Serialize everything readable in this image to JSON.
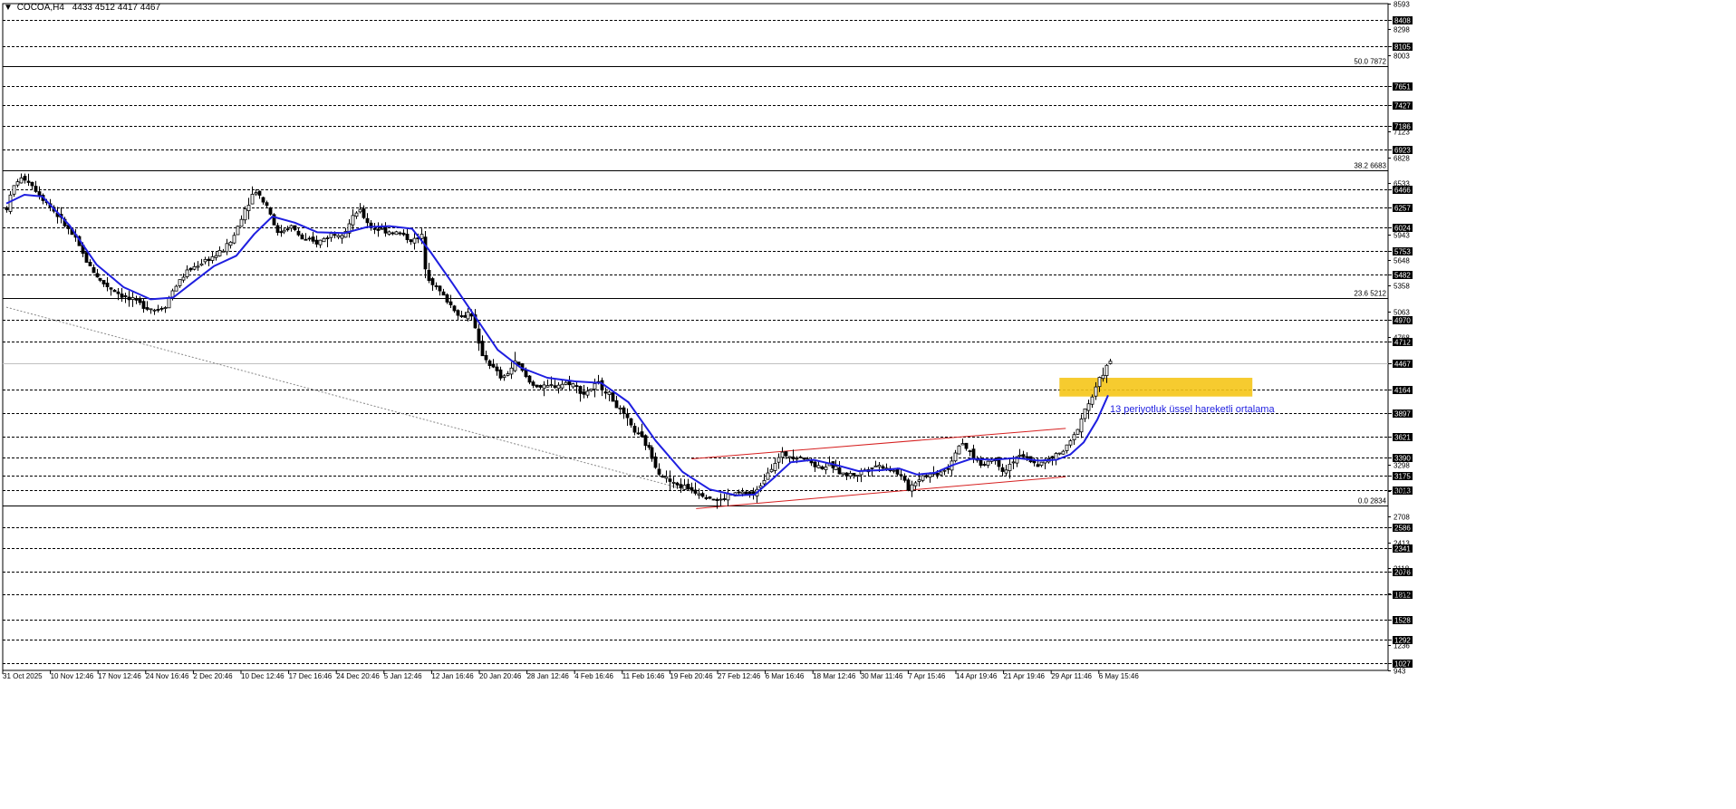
{
  "header": {
    "symbol": "COCOA,H4",
    "ohlc": "4433 4512 4417 4467"
  },
  "annotation": {
    "text": "13 periyotluk üssel hareketli ortalama"
  },
  "colors": {
    "candle": "#000000",
    "ema": "#1f1fe0",
    "channel": "#d62020",
    "zone": "#f5c518",
    "annotation": "#1f1fe0",
    "grid": "#000000",
    "fib": "#000000"
  },
  "chart_data": {
    "type": "candlestick",
    "title": "COCOA,H4",
    "ylim": [
      943,
      8593
    ],
    "grid": true,
    "y_ticks_plain": [
      8593,
      8298,
      8003,
      7123,
      6828,
      6533,
      5943,
      5648,
      5358,
      5063,
      4768,
      3298,
      3003,
      2708,
      2413,
      2118,
      1823,
      1236,
      943
    ],
    "y_levels_boxed": [
      8408,
      8105,
      7651,
      7427,
      7186,
      6923,
      6466,
      6257,
      6024,
      5753,
      5482,
      4970,
      4712,
      4467,
      4164,
      3897,
      3621,
      3390,
      3175,
      3013,
      2586,
      2341,
      2076,
      1812,
      1528,
      1292,
      1027
    ],
    "fib_levels": [
      {
        "label": "50.0 7872",
        "value": 7872
      },
      {
        "label": "38.2 6683",
        "value": 6683
      },
      {
        "label": "23.6 5212",
        "value": 5212
      },
      {
        "label": "0.0 2834",
        "value": 2834
      }
    ],
    "x_labels": [
      "31 Oct 2025",
      "10 Nov 12:46",
      "17 Nov 12:46",
      "24 Nov 16:46",
      "2 Dec 20:46",
      "10 Dec 12:46",
      "17 Dec 16:46",
      "24 Dec 20:46",
      "5 Jan 12:46",
      "12 Jan 16:46",
      "20 Jan 20:46",
      "28 Jan 12:46",
      "4 Feb 16:46",
      "11 Feb 16:46",
      "19 Feb 20:46",
      "27 Feb 12:46",
      "6 Mar 16:46",
      "18 Mar 12:46",
      "30 Mar 11:46",
      "7 Apr 15:46",
      "14 Apr 19:46",
      "21 Apr 19:46",
      "29 Apr 11:46",
      "6 May 15:46"
    ],
    "price_path": [
      [
        0,
        6250
      ],
      [
        10,
        6560
      ],
      [
        22,
        6590
      ],
      [
        35,
        6420
      ],
      [
        55,
        6180
      ],
      [
        75,
        5900
      ],
      [
        90,
        5600
      ],
      [
        105,
        5400
      ],
      [
        120,
        5300
      ],
      [
        135,
        5200
      ],
      [
        150,
        5140
      ],
      [
        165,
        5080
      ],
      [
        175,
        5120
      ],
      [
        185,
        5320
      ],
      [
        200,
        5520
      ],
      [
        220,
        5650
      ],
      [
        235,
        5720
      ],
      [
        250,
        5880
      ],
      [
        262,
        6200
      ],
      [
        275,
        6460
      ],
      [
        290,
        6250
      ],
      [
        300,
        5950
      ],
      [
        315,
        6050
      ],
      [
        330,
        5870
      ],
      [
        345,
        5850
      ],
      [
        360,
        5950
      ],
      [
        375,
        5980
      ],
      [
        390,
        6230
      ],
      [
        405,
        6020
      ],
      [
        420,
        5990
      ],
      [
        435,
        5960
      ],
      [
        450,
        5870
      ],
      [
        460,
        5920
      ],
      [
        465,
        5500
      ],
      [
        475,
        5350
      ],
      [
        490,
        5160
      ],
      [
        505,
        4980
      ],
      [
        515,
        5080
      ],
      [
        525,
        4620
      ],
      [
        535,
        4470
      ],
      [
        550,
        4280
      ],
      [
        565,
        4480
      ],
      [
        580,
        4250
      ],
      [
        595,
        4180
      ],
      [
        610,
        4220
      ],
      [
        625,
        4250
      ],
      [
        640,
        4120
      ],
      [
        655,
        4230
      ],
      [
        665,
        4150
      ],
      [
        680,
        3920
      ],
      [
        695,
        3700
      ],
      [
        710,
        3520
      ],
      [
        725,
        3200
      ],
      [
        740,
        3080
      ],
      [
        755,
        3040
      ],
      [
        770,
        2980
      ],
      [
        790,
        2880
      ],
      [
        800,
        2950
      ],
      [
        815,
        2980
      ],
      [
        830,
        2960
      ],
      [
        845,
        3250
      ],
      [
        860,
        3420
      ],
      [
        880,
        3400
      ],
      [
        900,
        3280
      ],
      [
        915,
        3290
      ],
      [
        930,
        3180
      ],
      [
        945,
        3200
      ],
      [
        960,
        3300
      ],
      [
        975,
        3280
      ],
      [
        990,
        3200
      ],
      [
        1000,
        3030
      ],
      [
        1015,
        3180
      ],
      [
        1030,
        3200
      ],
      [
        1045,
        3280
      ],
      [
        1055,
        3530
      ],
      [
        1065,
        3480
      ],
      [
        1080,
        3300
      ],
      [
        1095,
        3380
      ],
      [
        1105,
        3230
      ],
      [
        1120,
        3400
      ],
      [
        1135,
        3360
      ],
      [
        1145,
        3300
      ],
      [
        1160,
        3380
      ],
      [
        1175,
        3480
      ],
      [
        1185,
        3650
      ],
      [
        1195,
        3920
      ],
      [
        1205,
        4100
      ],
      [
        1212,
        4280
      ],
      [
        1218,
        4400
      ],
      [
        1224,
        4467
      ]
    ],
    "ema_path": [
      [
        0,
        6300
      ],
      [
        20,
        6400
      ],
      [
        40,
        6380
      ],
      [
        70,
        6050
      ],
      [
        100,
        5600
      ],
      [
        130,
        5340
      ],
      [
        160,
        5200
      ],
      [
        185,
        5220
      ],
      [
        205,
        5380
      ],
      [
        230,
        5580
      ],
      [
        255,
        5700
      ],
      [
        275,
        5950
      ],
      [
        295,
        6150
      ],
      [
        320,
        6080
      ],
      [
        345,
        5970
      ],
      [
        375,
        5960
      ],
      [
        400,
        6030
      ],
      [
        425,
        6040
      ],
      [
        450,
        6010
      ],
      [
        470,
        5750
      ],
      [
        495,
        5380
      ],
      [
        520,
        5000
      ],
      [
        545,
        4620
      ],
      [
        570,
        4420
      ],
      [
        600,
        4300
      ],
      [
        630,
        4260
      ],
      [
        660,
        4240
      ],
      [
        690,
        4020
      ],
      [
        720,
        3580
      ],
      [
        750,
        3220
      ],
      [
        780,
        3020
      ],
      [
        810,
        2950
      ],
      [
        830,
        2960
      ],
      [
        850,
        3140
      ],
      [
        870,
        3330
      ],
      [
        895,
        3360
      ],
      [
        920,
        3300
      ],
      [
        945,
        3230
      ],
      [
        970,
        3240
      ],
      [
        990,
        3260
      ],
      [
        1010,
        3190
      ],
      [
        1030,
        3210
      ],
      [
        1050,
        3300
      ],
      [
        1070,
        3370
      ],
      [
        1095,
        3360
      ],
      [
        1120,
        3380
      ],
      [
        1145,
        3350
      ],
      [
        1165,
        3360
      ],
      [
        1180,
        3420
      ],
      [
        1195,
        3560
      ],
      [
        1210,
        3820
      ],
      [
        1222,
        4100
      ]
    ],
    "channel_lines": [
      {
        "from": [
          760,
          3370
        ],
        "to": [
          1175,
          3720
        ]
      },
      {
        "from": [
          765,
          2800
        ],
        "to": [
          1175,
          3165
        ]
      }
    ],
    "dotted_trend": {
      "from": [
        0,
        5110
      ],
      "to": [
        770,
        2970
      ]
    },
    "zone": {
      "x_from": 1168,
      "x_to": 1382,
      "y_from": 4085,
      "y_to": 4300
    },
    "last_price": 4467
  }
}
